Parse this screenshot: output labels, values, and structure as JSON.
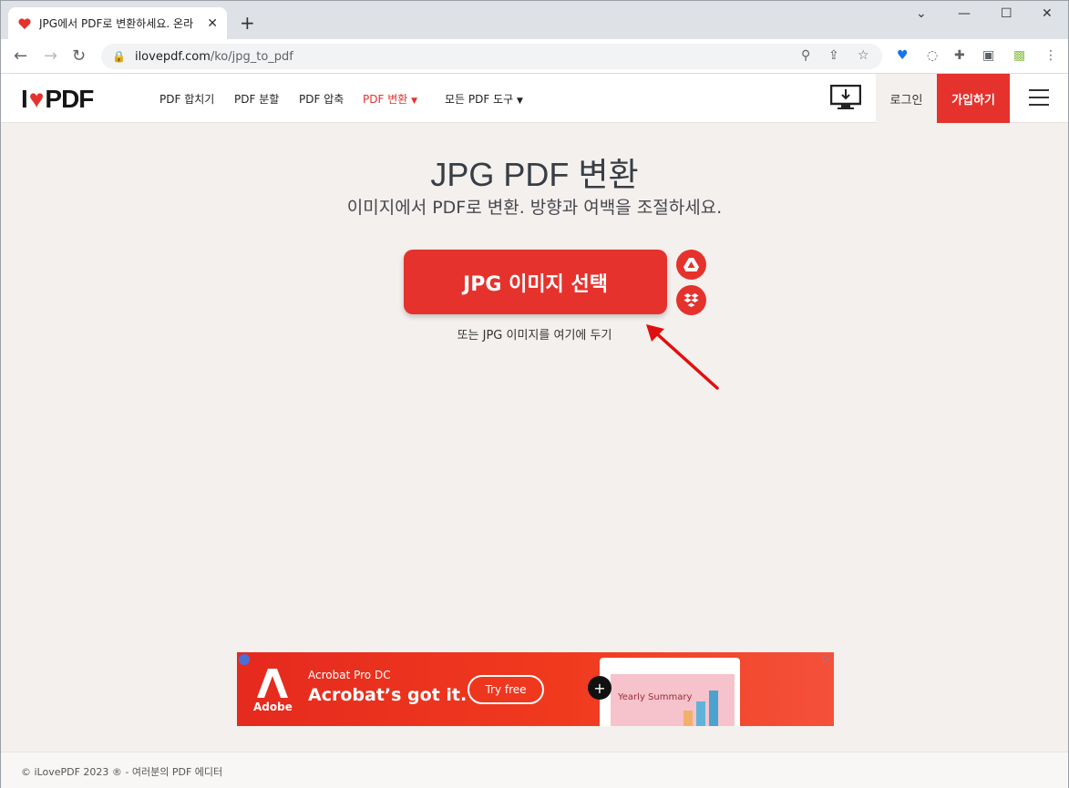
{
  "browser": {
    "tab_title": "JPG에서 PDF로 변환하세요. 온라",
    "url_domain": "ilovepdf.com",
    "url_path": "/ko/jpg_to_pdf"
  },
  "header": {
    "logo_left": "I",
    "logo_right": "PDF",
    "nav": [
      {
        "label": "PDF 합치기"
      },
      {
        "label": "PDF 분할"
      },
      {
        "label": "PDF 압축"
      },
      {
        "label": "PDF 변환"
      },
      {
        "label": "모든 PDF 도구"
      }
    ],
    "login": "로그인",
    "signup": "가입하기"
  },
  "main": {
    "title": "JPG PDF 변환",
    "subtitle": "이미지에서 PDF로 변환. 방향과 여백을 조절하세요.",
    "select_button": "JPG 이미지 선택",
    "drop_text": "또는 JPG 이미지를 여기에 두기"
  },
  "ad": {
    "brand": "Adobe",
    "product": "Acrobat Pro DC",
    "tagline": "Acrobat’s got it.",
    "cta": "Try free",
    "preview_text": "Yearly Summary"
  },
  "footer": {
    "text": "© iLovePDF 2023 ® - 여러분의 PDF 에디터"
  },
  "colors": {
    "brand_red": "#e5322d",
    "background": "#f3f0ed"
  }
}
